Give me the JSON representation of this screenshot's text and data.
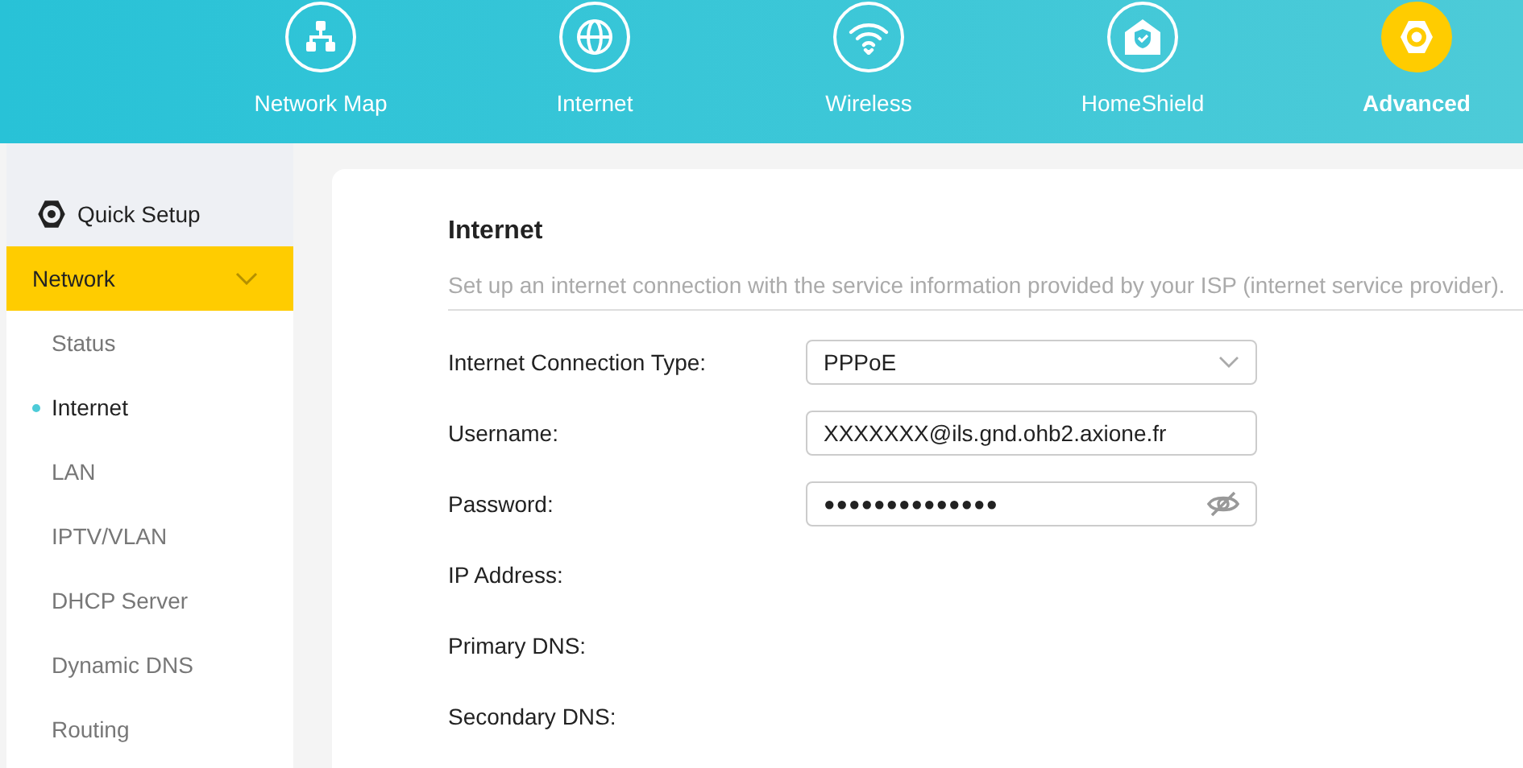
{
  "nav": [
    {
      "label": "Network Map",
      "kind": "network-map",
      "selected": false
    },
    {
      "label": "Internet",
      "kind": "internet",
      "selected": false
    },
    {
      "label": "Wireless",
      "kind": "wireless",
      "selected": false
    },
    {
      "label": "HomeShield",
      "kind": "homeshield",
      "selected": false
    },
    {
      "label": "Advanced",
      "kind": "advanced",
      "selected": true
    }
  ],
  "sidebar": {
    "quick_setup": "Quick Setup",
    "group": {
      "label": "Network",
      "expanded": true,
      "children": [
        {
          "label": "Status",
          "selected": false
        },
        {
          "label": "Internet",
          "selected": true
        },
        {
          "label": "LAN",
          "selected": false
        },
        {
          "label": "IPTV/VLAN",
          "selected": false
        },
        {
          "label": "DHCP Server",
          "selected": false
        },
        {
          "label": "Dynamic DNS",
          "selected": false
        },
        {
          "label": "Routing",
          "selected": false
        }
      ]
    }
  },
  "content": {
    "title": "Internet",
    "description": "Set up an internet connection with the service information provided by your ISP (internet service provider).",
    "fields": [
      {
        "label": "Internet Connection Type:",
        "kind": "select",
        "value": "PPPoE"
      },
      {
        "label": "Username:",
        "kind": "text",
        "value": "XXXXXXX@ils.gnd.ohb2.axione.fr"
      },
      {
        "label": "Password:",
        "kind": "password",
        "value": "●●●●●●●●●●●●●●"
      },
      {
        "label": "IP Address:",
        "kind": "info"
      },
      {
        "label": "Primary DNS:",
        "kind": "info"
      },
      {
        "label": "Secondary DNS:",
        "kind": "info"
      }
    ]
  }
}
